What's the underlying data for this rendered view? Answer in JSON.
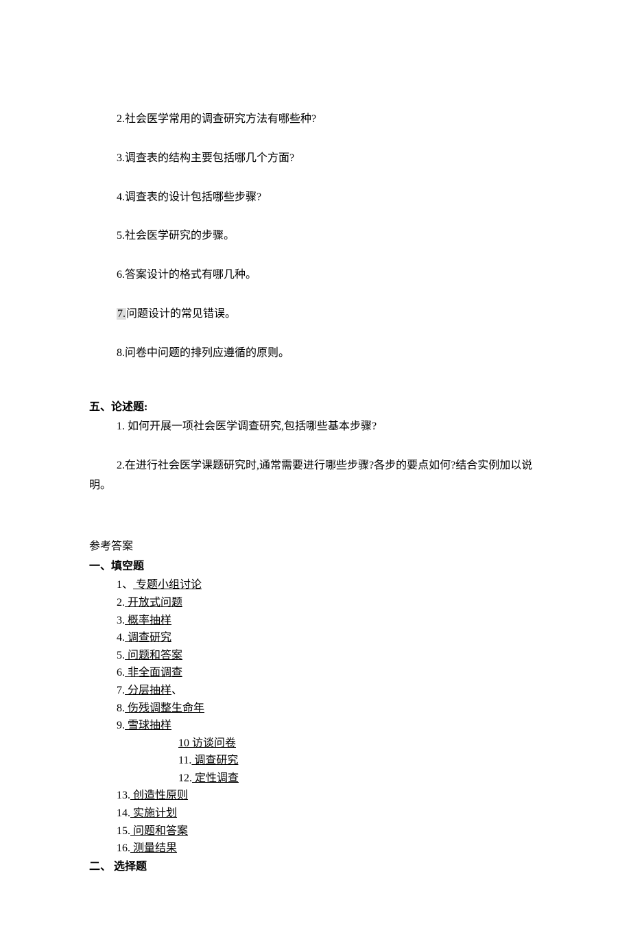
{
  "questions": {
    "q2": "2.社会医学常用的调查研究方法有哪些种?",
    "q3": "3.调查表的结构主要包括哪几个方面?",
    "q4": "4.调查表的设计包括哪些步骤?",
    "q5": "5.社会医学研究的步骤。",
    "q6": "6.答案设计的格式有哪几种。",
    "q7_num": "7.",
    "q7_text": "问题设计的常见错误。",
    "q8": "8.问卷中问题的排列应遵循的原则。"
  },
  "section5": {
    "header": "五、论述题:",
    "q1": "1. 如何开展一项社会医学调查研究,包括哪些基本步骤?",
    "q2": "2.在进行社会医学课题研究时,通常需要进行哪些步骤?各步的要点如何?结合实例加以说明。"
  },
  "answers_label": "参考答案",
  "fill_header": "一、填空题",
  "fill": {
    "a1_num": "1、",
    "a1_ans": " 专题小组讨论",
    "a2_num": "2.",
    "a2_ans": "   开放式问题",
    "a3_num": "3.",
    "a3_ans": "  概率抽样  ",
    "a4_num": "4.",
    "a4_ans": "   调查研究",
    "a5_num": "5.",
    "a5_ans": "  问题和答案  ",
    "a6_num": "6.",
    "a6_ans": "  非全面调查 ",
    "a7_num": "7.",
    "a7_ans": "  分层抽样",
    "a7_suffix": "、",
    "a8_num": "8.",
    "a8_ans": "   伤残调整生命年",
    "a9_num": "9.",
    "a9_ans": "  雪球抽样  ",
    "a10_all": "10   访谈问卷  ",
    "a11_num": "11.",
    "a11_ans": "  调查研究  ",
    "a12_num": "12.",
    "a12_ans": "   定性调查  ",
    "a13_num": "13.",
    "a13_ans": "  创造性原则 ",
    "a14_num": "14.",
    "a14_ans": "  实施计划  ",
    "a15_num": "15.",
    "a15_ans": " 问题和答案 ",
    "a16_num": "16.",
    "a16_ans": " 测量结果 "
  },
  "choice_header": "二、 选择题"
}
